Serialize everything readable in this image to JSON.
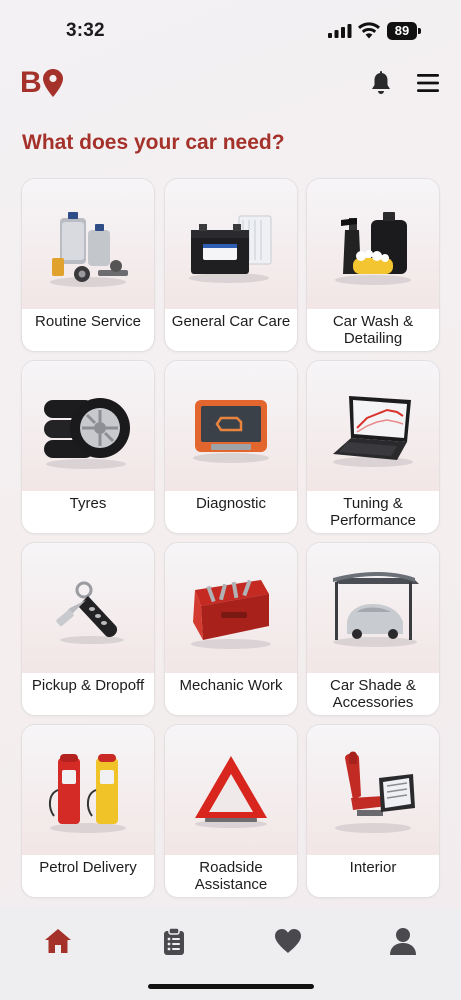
{
  "status_bar": {
    "time": "3:32",
    "battery": "89",
    "icons": [
      "signal-icon",
      "wifi-icon",
      "battery-icon"
    ]
  },
  "header": {
    "logo_letter": "B",
    "icons": [
      "location-pin-icon",
      "bell-icon",
      "hamburger-menu-icon"
    ]
  },
  "page": {
    "title": "What does your car need?"
  },
  "categories": [
    {
      "label": "Routine Service",
      "icon": "oil-service-icon"
    },
    {
      "label": "General Car Care",
      "icon": "battery-filter-icon"
    },
    {
      "label": "Car Wash & Detailing",
      "icon": "car-wash-icon"
    },
    {
      "label": "Tyres",
      "icon": "tyres-icon"
    },
    {
      "label": "Diagnostic",
      "icon": "diagnostic-tablet-icon"
    },
    {
      "label": "Tuning & Performance",
      "icon": "laptop-graph-icon"
    },
    {
      "label": "Pickup & Dropoff",
      "icon": "car-key-icon"
    },
    {
      "label": "Mechanic Work",
      "icon": "toolbox-icon"
    },
    {
      "label": "Car Shade & Accessories",
      "icon": "car-shade-icon"
    },
    {
      "label": "Petrol Delivery",
      "icon": "fuel-pump-icon"
    },
    {
      "label": "Roadside Assistance",
      "icon": "warning-triangle-icon"
    },
    {
      "label": "Interior",
      "icon": "car-seat-icon"
    }
  ],
  "bottom_nav": [
    {
      "name": "home",
      "icon": "home-icon",
      "active": true
    },
    {
      "name": "orders",
      "icon": "clipboard-icon",
      "active": false
    },
    {
      "name": "favorites",
      "icon": "heart-icon",
      "active": false
    },
    {
      "name": "profile",
      "icon": "user-icon",
      "active": false
    }
  ],
  "colors": {
    "brand": "#a4322a",
    "nav_inactive": "#4a4a4e",
    "card_bg": "#ffffff"
  }
}
